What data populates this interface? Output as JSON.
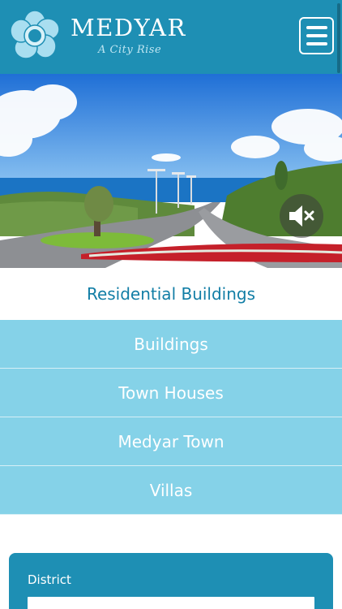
{
  "header": {
    "brand": "MEDYAR",
    "tagline": "A City Rise",
    "menu_icon": "hamburger-menu-icon",
    "accent_color": "#1e8fb4"
  },
  "hero": {
    "mute_icon": "volume-mute-icon"
  },
  "section": {
    "title": "Residential Buildings"
  },
  "categories": [
    {
      "label": "Buildings"
    },
    {
      "label": "Town Houses"
    },
    {
      "label": "Medyar Town"
    },
    {
      "label": "Villas"
    }
  ],
  "filter": {
    "district_label": "District",
    "district_value": ""
  }
}
